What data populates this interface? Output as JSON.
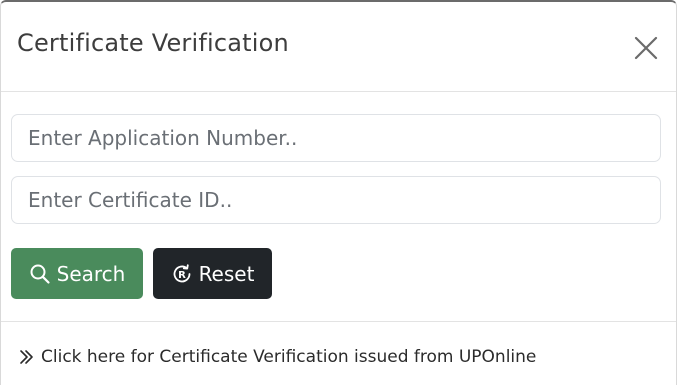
{
  "modal": {
    "title": "Certificate Verification",
    "close_icon": "close-icon"
  },
  "form": {
    "application_number": {
      "value": "",
      "placeholder": "Enter Application Number.."
    },
    "certificate_id": {
      "value": "",
      "placeholder": "Enter Certificate ID.."
    },
    "search_label": "Search",
    "search_icon": "search-icon",
    "reset_label": "Reset",
    "reset_icon": "reset-icon"
  },
  "footer": {
    "link_text": "Click here for Certificate Verification issued from UPOnline",
    "link_icon": "double-chevron-right-icon"
  },
  "colors": {
    "search_button": "#4a8b5c",
    "reset_button": "#212529",
    "title_text": "#3d3d3d"
  }
}
